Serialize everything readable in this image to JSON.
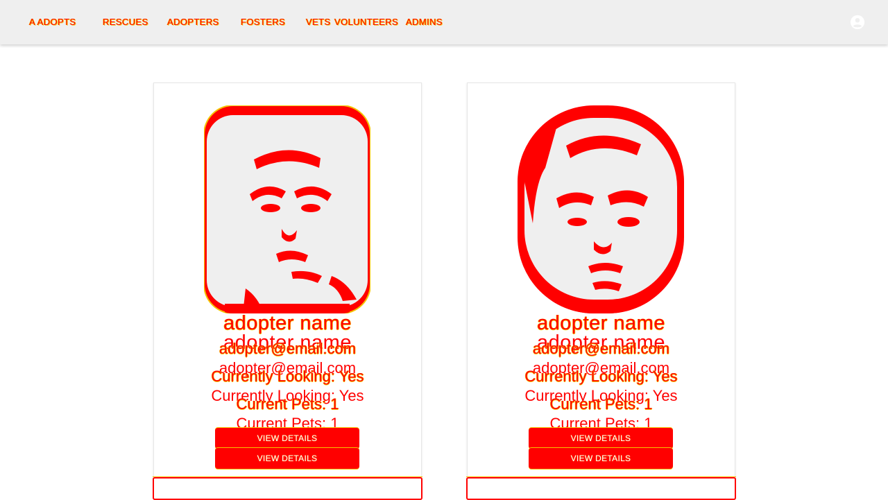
{
  "nav": {
    "brand": "A ADOPTS",
    "links": [
      "RESCUES",
      "ADOPTERS",
      "FOSTERS",
      "VETS",
      "VOLUNTEERS",
      "ADMINS"
    ],
    "account_icon": "account-circle-icon"
  },
  "adopters": [
    {
      "name": "adopter name",
      "email": "adopter@email.com",
      "currently_looking": "Currently Looking: Yes",
      "current_pets": "Current Pets: 1",
      "button_label": "VIEW DETAILS"
    },
    {
      "name": "adopter name",
      "email": "adopter@email.com",
      "currently_looking": "Currently Looking: Yes",
      "current_pets": "Current Pets: 1",
      "button_label": "VIEW DETAILS"
    }
  ],
  "colors": {
    "accent": "#ff0000",
    "outline": "#f5c400",
    "navbar": "#efefef",
    "background": "#ffffff"
  }
}
